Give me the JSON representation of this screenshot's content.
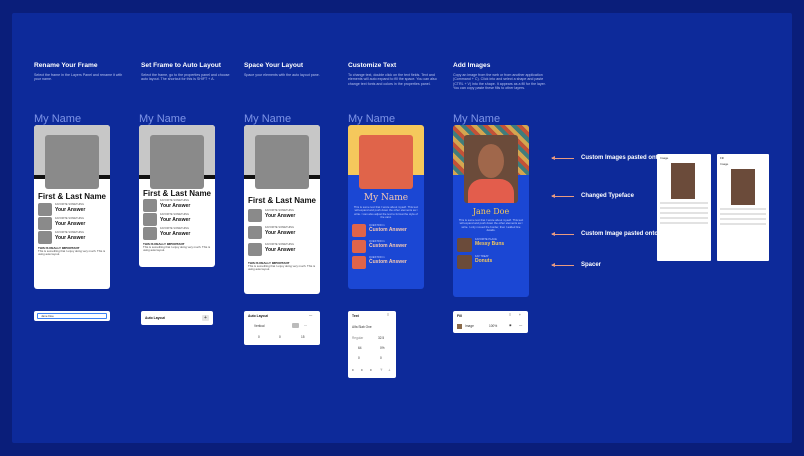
{
  "steps": [
    {
      "title": "Rename Your Frame",
      "desc": "Select the frame in the Layers Panel and rename it with your name."
    },
    {
      "title": "Set Frame to Auto Layout",
      "desc": "Select the frame, go to the properties panel and choose auto layout. The shortcut for this is SHIFT + A."
    },
    {
      "title": "Space Your Layout",
      "desc": "Space your elements with the auto layout pane."
    },
    {
      "title": "Customize Text",
      "desc": "To change text, double click on the text fields. Text and elements will auto expand to fill the space. You can also change text fonts and colors in the properties panel."
    },
    {
      "title": "Add Images",
      "desc": "Copy an image from the web or from another application (Command + C). Click into and select a shape and paste (CTRL + V) into the shape. It appears as a fill for the layer. You can copy paste these fills to other layers."
    }
  ],
  "frame_label": "My Name",
  "card": {
    "name": "First & Last Name",
    "fav": "FAVORITE SOMETHING",
    "answer": "Your Answer",
    "important": "THIS IS REALLY IMPORTANT",
    "important_desc": "This is something that I enjoy doing very much. This is using auto layout."
  },
  "custom_card": {
    "name": "My Name",
    "desc": "This is some text that I wrote about myself. This text will expand and push down the other elements as I write. I can also adjust the text to format the style of the card.",
    "question": "QUESTION 1",
    "answer": "Custom Answer"
  },
  "image_card": {
    "name": "Jane Doe",
    "desc": "This is some text that I wrote about myself. This text will expand and push down the other elements as I write. I only moved the border, then I added line details.",
    "q1": "FAVORITE PLACE",
    "a1": "Messy Buns",
    "q2": "FAV TREAT",
    "a2": "Donuts"
  },
  "panels": {
    "p1_text": "Jane Doe",
    "p2_title": "Auto Layout",
    "p3_title": "Auto Layout",
    "p3_dir": "Vertical",
    "p3_v1": "0",
    "p3_v2": "0",
    "p3_v3": "15",
    "p4_title": "Text",
    "p4_font": "Alfa Slab One",
    "p4_weight": "Regular",
    "p4_size": "32.5",
    "p4_lh": "64",
    "p4_ls": "0%",
    "p4_p1": "0",
    "p4_p2": "0",
    "p5_title": "Fill",
    "p5_label": "Image",
    "p5_opacity": "100%",
    "ss1_label": "Image",
    "ss2_label": "Fill",
    "ss2_img": "Image"
  },
  "annotations": [
    "Custom Images pasted onto Shapes",
    "Changed Typeface",
    "Custom Image pasted onto Shape",
    "Spacer"
  ],
  "colors": {
    "bg": "#0d2a9a",
    "accent": "#e89a80",
    "blue_card": "#1b47d4",
    "coral": "#e0644a",
    "yellow": "#f5c85c"
  }
}
